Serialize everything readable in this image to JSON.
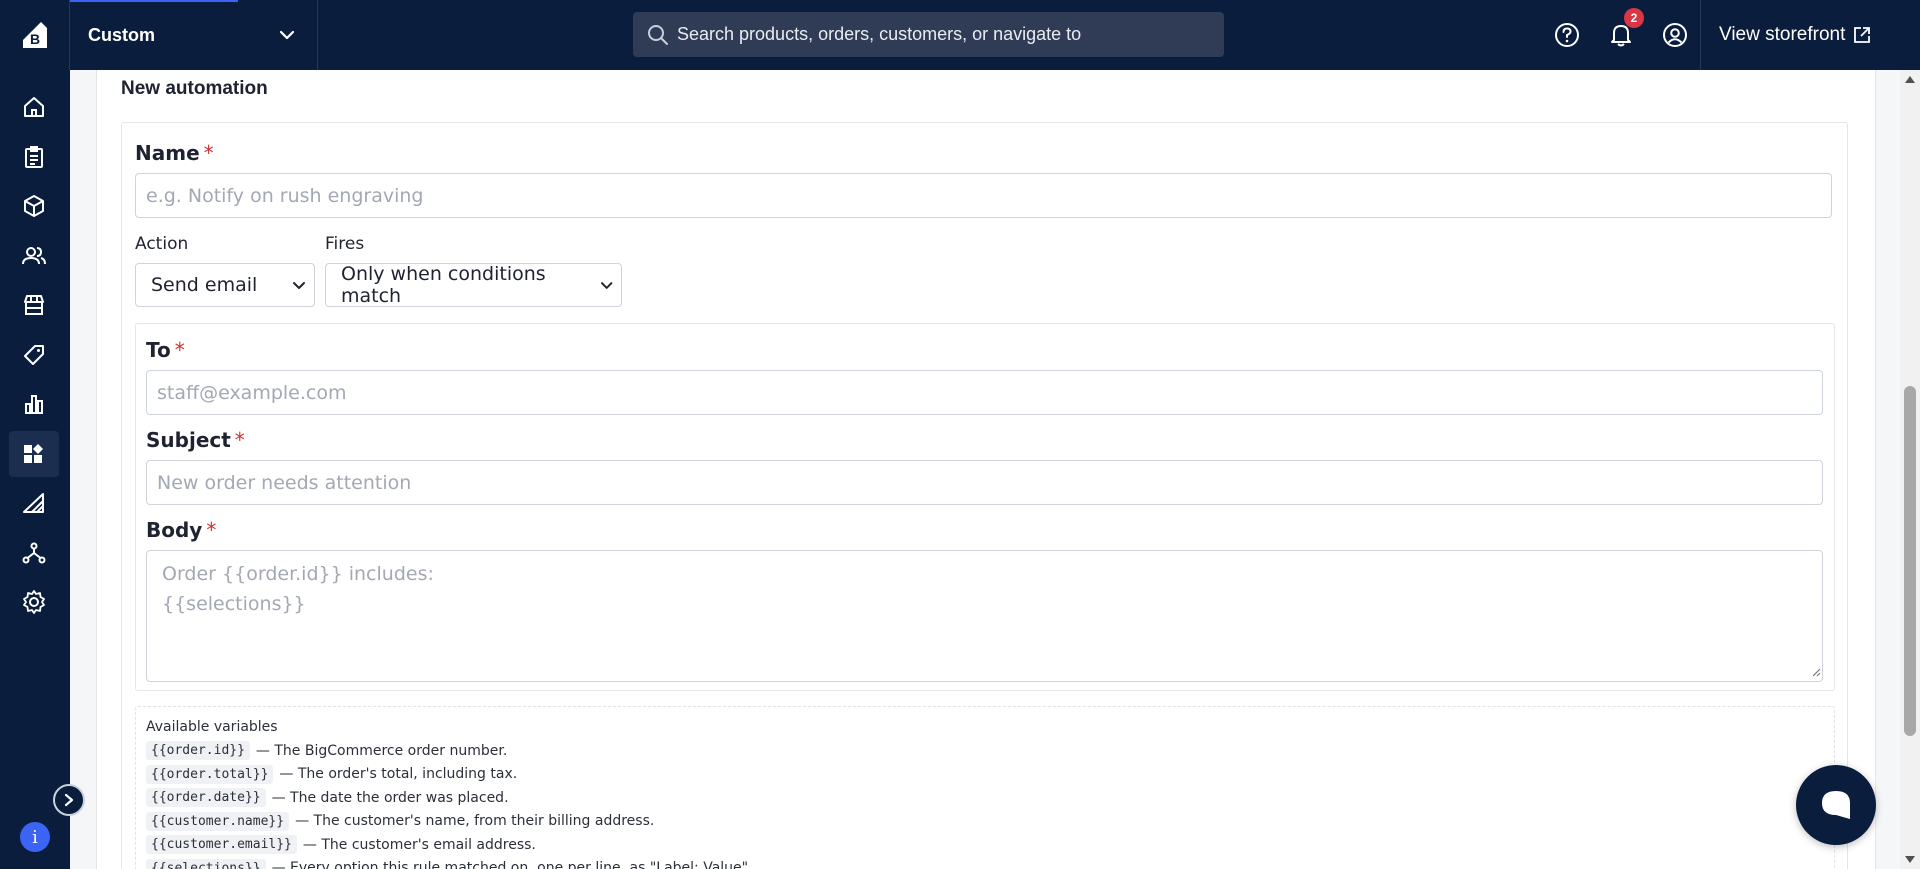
{
  "topbar": {
    "store_name": "Custom",
    "search_placeholder": "Search products, orders, customers, or navigate to",
    "notifications_count": "2",
    "storefront_label": "View storefront"
  },
  "sidebar": {
    "items": [
      {
        "name": "home-icon"
      },
      {
        "name": "orders-icon"
      },
      {
        "name": "products-icon"
      },
      {
        "name": "customers-icon"
      },
      {
        "name": "storefront-icon"
      },
      {
        "name": "marketing-icon"
      },
      {
        "name": "analytics-icon"
      },
      {
        "name": "apps-icon",
        "active": true
      },
      {
        "name": "channels-icon"
      },
      {
        "name": "integrations-icon"
      },
      {
        "name": "settings-icon"
      }
    ],
    "info_label": "i"
  },
  "form": {
    "section_title": "New automation",
    "name_label": "Name",
    "name_placeholder": "e.g. Notify on rush engraving",
    "action_label": "Action",
    "action_value": "Send email",
    "fires_label": "Fires",
    "fires_value": "Only when conditions match",
    "to_label": "To",
    "to_placeholder": "staff@example.com",
    "subject_label": "Subject",
    "subject_placeholder": "New order needs attention",
    "body_label": "Body",
    "body_placeholder": "Order {{order.id}} includes:\n{{selections}}",
    "required_mark": "*"
  },
  "variables": {
    "title": "Available variables",
    "items": [
      {
        "code": "{{order.id}}",
        "desc": "— The BigCommerce order number."
      },
      {
        "code": "{{order.total}}",
        "desc": "— The order's total, including tax."
      },
      {
        "code": "{{order.date}}",
        "desc": "— The date the order was placed."
      },
      {
        "code": "{{customer.name}}",
        "desc": "— The customer's name, from their billing address."
      },
      {
        "code": "{{customer.email}}",
        "desc": "— The customer's email address."
      },
      {
        "code": "{{selections}}",
        "desc": "— Every option this rule matched on, one per line, as \"Label: Value\"."
      }
    ]
  },
  "colors": {
    "navy": "#0a1d3d",
    "accent_blue": "#3c64f4",
    "badge_red": "#db3643",
    "required_red": "#d32f2f"
  }
}
